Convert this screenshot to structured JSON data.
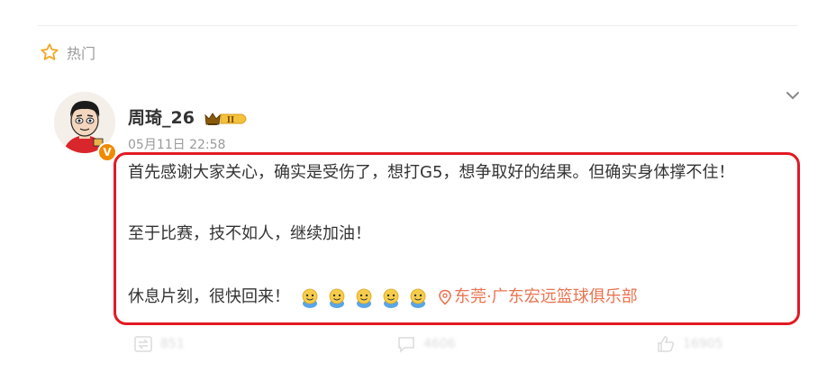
{
  "section": {
    "label": "热门",
    "icon": "star-icon"
  },
  "post": {
    "author": "周琦_26",
    "verified_mark": "V",
    "rank_badge": "II",
    "timestamp": "05月11日 22:58",
    "lines": [
      "首先感谢大家关心，确实是受伤了，想打G5，想争取好的结果。但确实身体撑不住！",
      "至于比赛，技不如人，继续加油！",
      "休息片刻，很快回来！"
    ],
    "emoji_count": 5,
    "location": "东莞·广东宏远篮球俱乐部"
  },
  "actions": {
    "repost": "851",
    "comment": "4606",
    "like": "16905"
  },
  "colors": {
    "highlight": "#e21a24",
    "location": "#eb7350",
    "muted": "#9a9a9a",
    "badge": "#f08a00"
  }
}
